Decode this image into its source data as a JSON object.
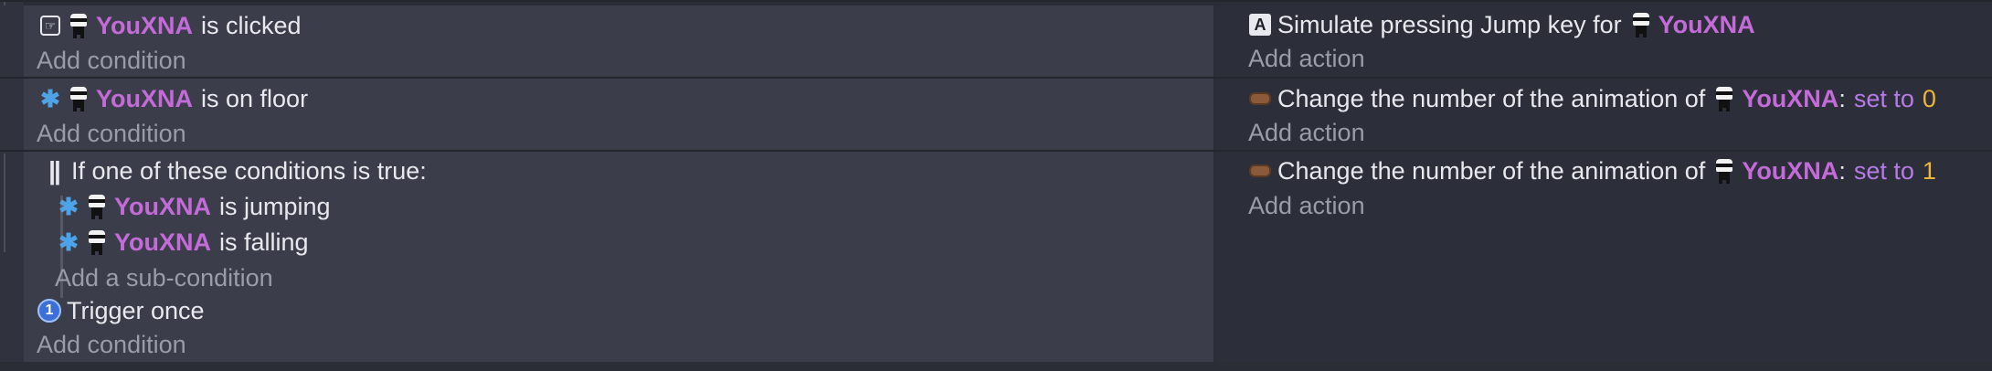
{
  "object_name": "YouXNA",
  "events": [
    {
      "conditions": [
        {
          "icon": "mouse-click-icon",
          "text": "is clicked"
        }
      ],
      "add_condition": "Add condition",
      "actions": [
        {
          "icon": "keyboard-key-icon",
          "text": "Simulate pressing Jump key for"
        }
      ],
      "add_action": "Add action"
    },
    {
      "conditions": [
        {
          "icon": "puzzle-icon",
          "text": "is on floor"
        }
      ],
      "add_condition": "Add condition",
      "actions": [
        {
          "icon": "animation-icon",
          "text": "Change the number of the animation of",
          "colon": ":",
          "op": "set to",
          "value": "0"
        }
      ],
      "add_action": "Add action"
    },
    {
      "or_group": {
        "icon": "or-condition-icon",
        "text": "If one of these conditions is true:",
        "subconditions": [
          {
            "icon": "puzzle-icon",
            "text": "is jumping"
          },
          {
            "icon": "puzzle-icon",
            "text": "is falling"
          }
        ],
        "add_subcondition": "Add a sub-condition"
      },
      "conditions": [
        {
          "icon": "trigger-once-icon",
          "icon_glyph": "1",
          "text": "Trigger once"
        }
      ],
      "add_condition": "Add condition",
      "actions": [
        {
          "icon": "animation-icon",
          "text": "Change the number of the animation of",
          "colon": ":",
          "op": "set to",
          "value": "1"
        }
      ],
      "add_action": "Add action"
    }
  ],
  "colors": {
    "object": "#c46bd9",
    "keyword": "#b67be8",
    "number": "#f0b43a",
    "add_link": "#9a9ca8"
  }
}
